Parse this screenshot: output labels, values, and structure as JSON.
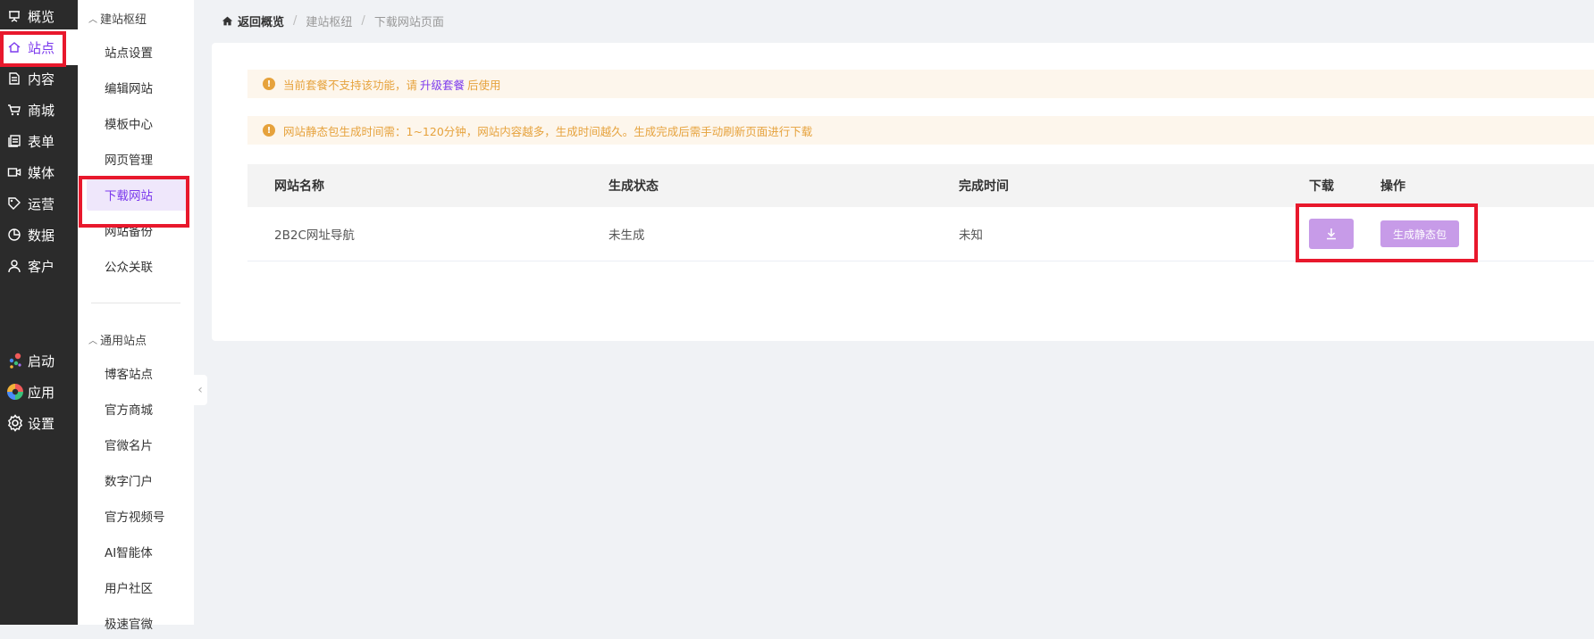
{
  "colors": {
    "accent": "#7c3aed",
    "rail_bg": "#2b2b2b",
    "warning": "#e6a23c",
    "button": "#c79be8",
    "annotation": "#e8182c"
  },
  "rail": {
    "items": [
      {
        "label": "概览",
        "icon": "presentation-icon"
      },
      {
        "label": "站点",
        "icon": "home-icon",
        "active": true
      },
      {
        "label": "内容",
        "icon": "document-icon"
      },
      {
        "label": "商城",
        "icon": "cart-icon"
      },
      {
        "label": "表单",
        "icon": "form-icon"
      },
      {
        "label": "媒体",
        "icon": "video-icon"
      },
      {
        "label": "运营",
        "icon": "tag-icon"
      },
      {
        "label": "数据",
        "icon": "pie-chart-icon"
      },
      {
        "label": "客户",
        "icon": "user-icon"
      }
    ],
    "bottom": [
      {
        "label": "启动",
        "icon": "launch-dots-icon"
      },
      {
        "label": "应用",
        "icon": "apps-color-icon"
      },
      {
        "label": "设置",
        "icon": "gear-icon"
      }
    ]
  },
  "submenu": {
    "group1": {
      "title": "建站枢纽",
      "items": [
        "站点设置",
        "编辑网站",
        "模板中心",
        "网页管理",
        "下载网站",
        "网站备份",
        "公众关联"
      ],
      "active": "下载网站"
    },
    "group2": {
      "title": "通用站点",
      "items": [
        "博客站点",
        "官方商城",
        "官微名片",
        "数字门户",
        "官方视频号",
        "AI智能体",
        "用户社区",
        "极速官微"
      ]
    }
  },
  "breadcrumb": {
    "home": "返回概览",
    "level1": "建站枢纽",
    "level2": "下载网站页面"
  },
  "alerts": {
    "plan": {
      "before": "当前套餐不支持该功能，请",
      "link": "升级套餐",
      "after": "后使用"
    },
    "info": "网站静态包生成时间需：1~120分钟，网站内容越多，生成时间越久。生成完成后需手动刷新页面进行下载"
  },
  "table": {
    "headers": [
      "网站名称",
      "生成状态",
      "完成时间",
      "下载",
      "操作"
    ],
    "rows": [
      {
        "name": "2B2C网址导航",
        "status": "未生成",
        "time": "未知",
        "action": "生成静态包"
      }
    ]
  }
}
